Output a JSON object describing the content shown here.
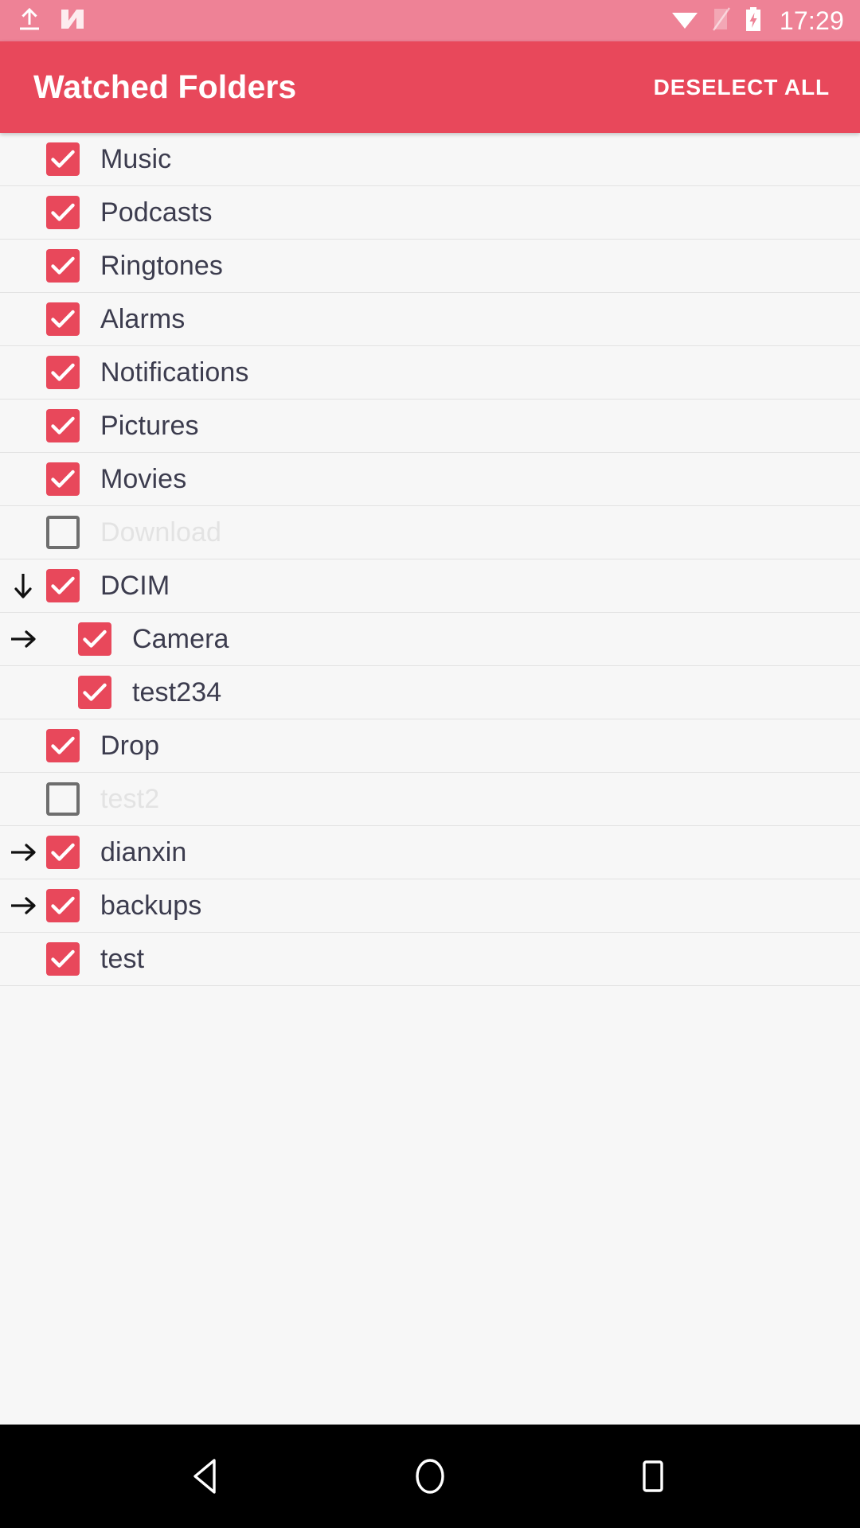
{
  "status_bar": {
    "left_icons": [
      {
        "name": "upload-icon",
        "label": "upload"
      },
      {
        "name": "android-nougat-logo-icon",
        "label": "N"
      }
    ],
    "right_icons": [
      {
        "name": "wifi-icon",
        "label": "wifi"
      },
      {
        "name": "no-sim-signal-icon",
        "label": "no signal"
      },
      {
        "name": "battery-charging-icon",
        "label": "charging"
      }
    ],
    "time": "17:29",
    "background_color": "#EE8296",
    "foreground_color": "#FFFFFF"
  },
  "app_bar": {
    "title": "Watched Folders",
    "action_label": "DESELECT ALL",
    "background_color": "#E8485B",
    "text_color": "#FFFFFF"
  },
  "list": {
    "background_color": "#F7F7F7",
    "divider_color": "#E2E2E2",
    "checked_color": "#E8485B",
    "unchecked_border_color": "#6E6E6E",
    "label_color": "#3C3C4E",
    "disabled_label_color": "#E3E3E3",
    "rows": [
      {
        "label": "Music",
        "checked": true,
        "indent": 0,
        "arrow": "none"
      },
      {
        "label": "Podcasts",
        "checked": true,
        "indent": 0,
        "arrow": "none"
      },
      {
        "label": "Ringtones",
        "checked": true,
        "indent": 0,
        "arrow": "none"
      },
      {
        "label": "Alarms",
        "checked": true,
        "indent": 0,
        "arrow": "none"
      },
      {
        "label": "Notifications",
        "checked": true,
        "indent": 0,
        "arrow": "none"
      },
      {
        "label": "Pictures",
        "checked": true,
        "indent": 0,
        "arrow": "none"
      },
      {
        "label": "Movies",
        "checked": true,
        "indent": 0,
        "arrow": "none"
      },
      {
        "label": "Download",
        "checked": false,
        "indent": 0,
        "arrow": "none"
      },
      {
        "label": "DCIM",
        "checked": true,
        "indent": 0,
        "arrow": "down"
      },
      {
        "label": "Camera",
        "checked": true,
        "indent": 1,
        "arrow": "right"
      },
      {
        "label": "test234",
        "checked": true,
        "indent": 1,
        "arrow": "none"
      },
      {
        "label": "Drop",
        "checked": true,
        "indent": 0,
        "arrow": "none"
      },
      {
        "label": "test2",
        "checked": false,
        "indent": 0,
        "arrow": "none"
      },
      {
        "label": "dianxin",
        "checked": true,
        "indent": 0,
        "arrow": "right"
      },
      {
        "label": "backups",
        "checked": true,
        "indent": 0,
        "arrow": "right"
      },
      {
        "label": "test",
        "checked": true,
        "indent": 0,
        "arrow": "none"
      }
    ]
  },
  "nav_bar": {
    "background_color": "#000000",
    "buttons": [
      {
        "name": "nav-back-button",
        "label": "Back"
      },
      {
        "name": "nav-home-button",
        "label": "Home"
      },
      {
        "name": "nav-recents-button",
        "label": "Recents"
      }
    ]
  }
}
